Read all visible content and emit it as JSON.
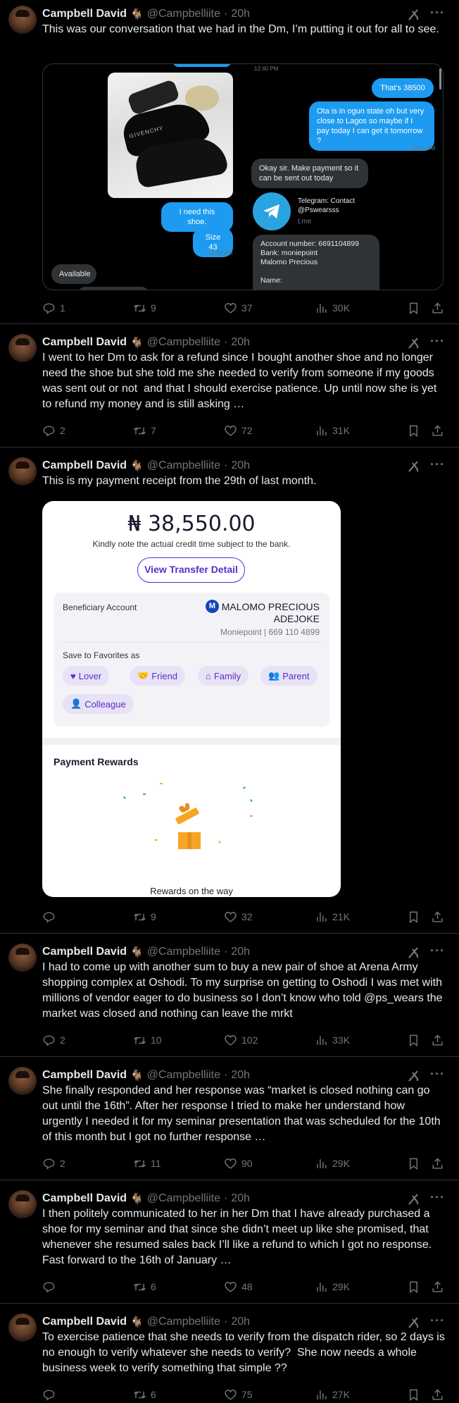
{
  "author": {
    "name": "Campbell David",
    "emoji": "🐐",
    "handle": "@Campbelliite",
    "time": "20h",
    "sep": "·"
  },
  "tweets": [
    {
      "text": "This was our conversation that we had in the Dm, I’m putting it out for all to see.",
      "replies": "1",
      "retweets": "9",
      "likes": "37",
      "views": "30K"
    },
    {
      "text": "I went to her Dm to ask for a refund since I bought another shoe and no longer need the shoe but she told me she needed to verify from someone if my goods was sent out or not  and that I should exercise patience. Up until now she is yet to refund my money and is still asking …",
      "replies": "2",
      "retweets": "7",
      "likes": "72",
      "views": "31K"
    },
    {
      "text": "This is my payment receipt from the 29th of last month.",
      "replies": "",
      "retweets": "9",
      "likes": "32",
      "views": "21K"
    },
    {
      "text": "I had to come up with another sum to buy a new pair of shoe at Arena Army shopping complex at Oshodi. To my surprise on getting to Oshodi I was met with millions of vendor eager to do business so I don’t know who told @ps_wears the market was closed and nothing can leave the mrkt",
      "replies": "2",
      "retweets": "10",
      "likes": "102",
      "views": "33K"
    },
    {
      "text": "She finally responded and her response was “market is closed nothing can go out until the 16th”. After her response I tried to make her understand how urgently I needed it for my seminar presentation that was scheduled for the 10th of this month but I got no further response …",
      "replies": "2",
      "retweets": "11",
      "likes": "90",
      "views": "29K"
    },
    {
      "text": "I then politely communicated to her in her Dm that I have already purchased a shoe for my seminar and that since she didn’t meet up like she promised, that whenever she resumed sales back I’ll like a refund to which I got no response. Fast forward to the 16th of January …",
      "replies": "",
      "retweets": "6",
      "likes": "48",
      "views": "29K"
    },
    {
      "text": "To exercise patience that she needs to verify from the dispatch rider, so 2 days is no enough to verify whatever she needs to verify?  She now needs a whole business week to verify something that simple ??",
      "replies": "",
      "retweets": "6",
      "likes": "75",
      "views": "27K"
    }
  ],
  "dm": {
    "ts_top": "12:40 PM",
    "thats": "That’s 38500",
    "ota": "Ota is in ogun state oh but very close to Lagos so maybe if I pay today I can get it tomorrow ?",
    "ts_1251": "12:51 PM",
    "okay": "Okay sir. Make payment so it can be sent out today",
    "tg_title": "Telegram: Contact @Pswearsss",
    "tg_domain": "t.me",
    "account": "Account number: 6691104899\nBank: moniepoint\nMalomo Precious\n\nName:",
    "need": "I need this shoe.",
    "size": "Size 43",
    "ts_1209": "12:09 PM",
    "available": "Available",
    "shoe_brand": "GIVENCHY"
  },
  "receipt": {
    "amount": "₦ 38,550.00",
    "note": "Kindly note the actual credit time subject to the bank.",
    "button": "View Transfer Detail",
    "beneficiary_label": "Beneficiary Account",
    "bank_logo": "M",
    "beneficiary_name": "MALOMO PRECIOUS ADEJOKE",
    "bank_detail": "Moniepoint | 669 110 4899",
    "save_label": "Save to Favorites as",
    "chips": [
      {
        "label": "Lover",
        "icon": "♥"
      },
      {
        "label": "Friend",
        "icon": "🤝"
      },
      {
        "label": "Family",
        "icon": "⌂"
      },
      {
        "label": "Parent",
        "icon": "👥"
      },
      {
        "label": "Colleague",
        "icon": "👤"
      }
    ],
    "rewards_title": "Payment Rewards",
    "rewards_status": "Rewards on the way"
  },
  "colors": {
    "accent": "#1d9bf0",
    "muted": "#71767b",
    "receipt_purple": "#5b2dc8"
  }
}
